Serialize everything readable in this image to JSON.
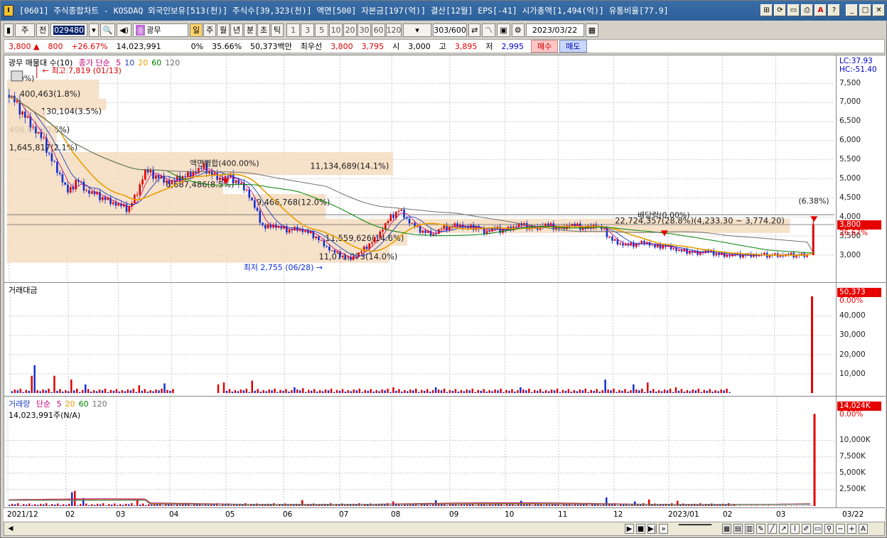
{
  "window": {
    "app_icon": "I",
    "title": "[0601] 주식종합차트 - KOSDAQ 외국인보유[513(천)] 주식수[39,323(천)] 액면[500] 자본금[197(억)] 결산[12월] EPS[-41] 시가총액[1,494(억)] 유통비율[77.9]",
    "buttons": [
      "window-tile-icon",
      "refresh-icon",
      "layout-icon",
      "print-icon",
      "font-icon",
      "help-icon",
      "minimize-icon",
      "maximize-icon",
      "close-icon"
    ],
    "button_glyphs": [
      "⊞",
      "⟳",
      "▭",
      "⎙",
      "A",
      "?",
      "_",
      "□",
      "✕"
    ]
  },
  "toolbar": {
    "market_type": "주",
    "mode": "전",
    "stock_code": "029480",
    "stock_name": "광무",
    "name_icon": "증",
    "periods": [
      "일",
      "주",
      "월",
      "년",
      "분",
      "초",
      "틱"
    ],
    "selected_period": "일",
    "minute_units": [
      "1",
      "3",
      "5",
      "10",
      "20",
      "30",
      "60",
      "120"
    ],
    "count": "303",
    "count_total": "/600",
    "date": "2023/03/22"
  },
  "quote": {
    "price": "3,800",
    "change": "800",
    "change_pct": "+26.67%",
    "volume": "14,023,991",
    "turnover_pct": "0%",
    "ratio": "35.66%",
    "amount": "50,373백만",
    "best_bid_label": "최우선",
    "best_ask": "3,800",
    "best_bid": "3,795",
    "open_label": "시",
    "open": "3,000",
    "high_label": "고",
    "high": "3,895",
    "low_label": "저",
    "low": "2,995",
    "buy_label": "매수",
    "sell_label": "매도"
  },
  "price_pane": {
    "legend_name": "광무 매물대 수(10)",
    "ma_label": "종가 단순",
    "ma_periods": [
      "5",
      "10",
      "20",
      "60",
      "120"
    ],
    "ma_colors": [
      "#c0007a",
      "#1f3fbf",
      "#e8a000",
      "#008000",
      "#707070"
    ],
    "axis_top_lc": "LC:37.93",
    "axis_top_hc": "HC:-51.40",
    "axis_ticks": [
      {
        "label": "7,500",
        "v": 7500
      },
      {
        "label": "7,000",
        "v": 7000
      },
      {
        "label": "6,500",
        "v": 6500
      },
      {
        "label": "6,000",
        "v": 6000
      },
      {
        "label": "5,500",
        "v": 5500
      },
      {
        "label": "5,000",
        "v": 5000
      },
      {
        "label": "4,500",
        "v": 4500
      },
      {
        "label": "4,000",
        "v": 4000
      },
      {
        "label": "3,500",
        "v": 3500
      },
      {
        "label": "3,000",
        "v": 3000
      }
    ],
    "last_price": "3,800",
    "last_pct": "26.67%",
    "high_marker": "최고 7,819 (01/13)",
    "low_marker": "최저 2,755 (06/28)",
    "top_left_box": "00%)",
    "event_split": "액면병합(400.00%)",
    "event_dividend": "배당락(0.00%)",
    "last_pct_note": "(6.38%)",
    "volume_profile": [
      {
        "label": "400,463(1.8%)"
      },
      {
        "label": "130,104(3.5%)"
      },
      {
        "label": "498,899(0.6%)"
      },
      {
        "label": "1,645,817(2.1%)"
      },
      {
        "label": "11,134,689(14.1%)"
      },
      {
        "label": "6,687,486(8.5%)"
      },
      {
        "label": "9,466,768(12.0%)"
      },
      {
        "label": "22,724,357(28.8%)(4,233.30 ~ 3,774.20)"
      },
      {
        "label": "11,559,626(14.6%)"
      },
      {
        "label": "11,071,073(14.0%)"
      }
    ]
  },
  "amount_pane": {
    "legend": "거래대금",
    "axis_ticks": [
      {
        "label": "40,000",
        "v": 40000
      },
      {
        "label": "30,000",
        "v": 30000
      },
      {
        "label": "20,000",
        "v": 20000
      },
      {
        "label": "10,000",
        "v": 10000
      }
    ],
    "last_value": "50,373",
    "last_pct": "0.00%"
  },
  "volume_pane": {
    "legend": "거래량",
    "ma_label": "단순",
    "ma_periods": [
      "5",
      "20",
      "60",
      "120"
    ],
    "sub_label": "14,023,991주(N/A)",
    "axis_ticks": [
      {
        "label": "10,000K",
        "v": 10000
      },
      {
        "label": "7,500K",
        "v": 7500
      },
      {
        "label": "5,000K",
        "v": 5000
      },
      {
        "label": "2,500K",
        "v": 2500
      }
    ],
    "last_value": "14,024K",
    "last_pct": "0.00%"
  },
  "x_axis": {
    "labels": [
      "2021/12",
      "02",
      "03",
      "04",
      "05",
      "06",
      "07",
      "08",
      "09",
      "10",
      "11",
      "12",
      "2023/01",
      "02",
      "03"
    ],
    "right_label": "03/22"
  },
  "chart_data": {
    "type": "candlestick",
    "title": "광무",
    "ylim": [
      2700,
      7900
    ],
    "close_path": [
      7200,
      6900,
      6600,
      6300,
      6000,
      5500,
      5100,
      4600,
      5000,
      4700,
      4600,
      4500,
      4400,
      4300,
      4200,
      4600,
      5200,
      5100,
      5000,
      4900,
      5000,
      5100,
      5200,
      5300,
      5100,
      5000,
      5050,
      4900,
      4700,
      4200,
      3700,
      3800,
      3700,
      3650,
      3700,
      3600,
      3500,
      3300,
      3100,
      3000,
      2900,
      3000,
      3200,
      3400,
      3700,
      4000,
      4200,
      3900,
      3700,
      3600,
      3550,
      3700,
      3750,
      3800,
      3700,
      3750,
      3600,
      3700,
      3650,
      3700,
      3800,
      3750,
      3700,
      3800,
      3750,
      3700,
      3800,
      3750,
      3700,
      3800,
      3650,
      3400,
      3300,
      3250,
      3300,
      3350,
      3200,
      3250,
      3200,
      3100,
      3100,
      3050,
      3100,
      3050,
      3000,
      3000,
      3000,
      3000,
      3000,
      3000,
      3000,
      3000,
      3000,
      3000,
      3000,
      3800
    ],
    "amount_last": 50373,
    "volume_last_k": 14024
  }
}
